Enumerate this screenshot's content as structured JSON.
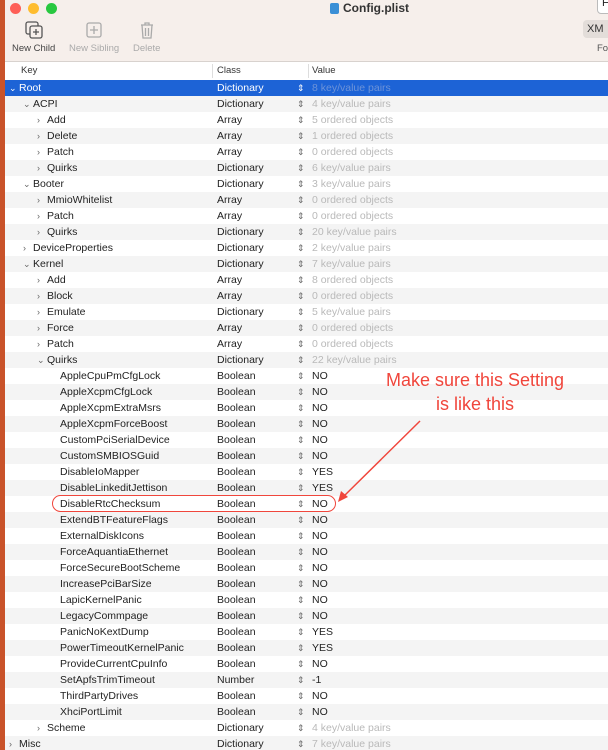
{
  "window": {
    "title": "Config.plist",
    "right_button": "F",
    "format_button": "XM",
    "format_label": "Fo"
  },
  "toolbar": {
    "new_child": "New Child",
    "new_sibling": "New Sibling",
    "delete": "Delete"
  },
  "columns": {
    "key": "Key",
    "class": "Class",
    "value": "Value"
  },
  "colors": {
    "selection": "#1d63d6",
    "annotation": "#f0463c",
    "close": "#fe5f57",
    "minimize": "#febc2e",
    "zoom": "#28c840"
  },
  "annotation": {
    "line1": "Make sure this Setting",
    "line2": "is like this",
    "highlighted_key": "DisableRtcChecksum"
  },
  "rows": [
    {
      "key": "Root",
      "class": "Dictionary",
      "value": "8 key/value pairs",
      "level": 0,
      "state": "open",
      "selected": true
    },
    {
      "key": "ACPI",
      "class": "Dictionary",
      "value": "4 key/value pairs",
      "level": 1,
      "state": "open"
    },
    {
      "key": "Add",
      "class": "Array",
      "value": "5 ordered objects",
      "level": 2,
      "state": "closed"
    },
    {
      "key": "Delete",
      "class": "Array",
      "value": "1 ordered objects",
      "level": 2,
      "state": "closed"
    },
    {
      "key": "Patch",
      "class": "Array",
      "value": "0 ordered objects",
      "level": 2,
      "state": "closed"
    },
    {
      "key": "Quirks",
      "class": "Dictionary",
      "value": "6 key/value pairs",
      "level": 2,
      "state": "closed"
    },
    {
      "key": "Booter",
      "class": "Dictionary",
      "value": "3 key/value pairs",
      "level": 1,
      "state": "open"
    },
    {
      "key": "MmioWhitelist",
      "class": "Array",
      "value": "0 ordered objects",
      "level": 2,
      "state": "closed"
    },
    {
      "key": "Patch",
      "class": "Array",
      "value": "0 ordered objects",
      "level": 2,
      "state": "closed"
    },
    {
      "key": "Quirks",
      "class": "Dictionary",
      "value": "20 key/value pairs",
      "level": 2,
      "state": "closed"
    },
    {
      "key": "DeviceProperties",
      "class": "Dictionary",
      "value": "2 key/value pairs",
      "level": 1,
      "state": "closed"
    },
    {
      "key": "Kernel",
      "class": "Dictionary",
      "value": "7 key/value pairs",
      "level": 1,
      "state": "open"
    },
    {
      "key": "Add",
      "class": "Array",
      "value": "8 ordered objects",
      "level": 2,
      "state": "closed"
    },
    {
      "key": "Block",
      "class": "Array",
      "value": "0 ordered objects",
      "level": 2,
      "state": "closed"
    },
    {
      "key": "Emulate",
      "class": "Dictionary",
      "value": "5 key/value pairs",
      "level": 2,
      "state": "closed"
    },
    {
      "key": "Force",
      "class": "Array",
      "value": "0 ordered objects",
      "level": 2,
      "state": "closed"
    },
    {
      "key": "Patch",
      "class": "Array",
      "value": "0 ordered objects",
      "level": 2,
      "state": "closed"
    },
    {
      "key": "Quirks",
      "class": "Dictionary",
      "value": "22 key/value pairs",
      "level": 2,
      "state": "open"
    },
    {
      "key": "AppleCpuPmCfgLock",
      "class": "Boolean",
      "value": "NO",
      "level": 3,
      "state": "leaf"
    },
    {
      "key": "AppleXcpmCfgLock",
      "class": "Boolean",
      "value": "NO",
      "level": 3,
      "state": "leaf"
    },
    {
      "key": "AppleXcpmExtraMsrs",
      "class": "Boolean",
      "value": "NO",
      "level": 3,
      "state": "leaf"
    },
    {
      "key": "AppleXcpmForceBoost",
      "class": "Boolean",
      "value": "NO",
      "level": 3,
      "state": "leaf"
    },
    {
      "key": "CustomPciSerialDevice",
      "class": "Boolean",
      "value": "NO",
      "level": 3,
      "state": "leaf"
    },
    {
      "key": "CustomSMBIOSGuid",
      "class": "Boolean",
      "value": "NO",
      "level": 3,
      "state": "leaf"
    },
    {
      "key": "DisableIoMapper",
      "class": "Boolean",
      "value": "YES",
      "level": 3,
      "state": "leaf"
    },
    {
      "key": "DisableLinkeditJettison",
      "class": "Boolean",
      "value": "YES",
      "level": 3,
      "state": "leaf"
    },
    {
      "key": "DisableRtcChecksum",
      "class": "Boolean",
      "value": "NO",
      "level": 3,
      "state": "leaf"
    },
    {
      "key": "ExtendBTFeatureFlags",
      "class": "Boolean",
      "value": "NO",
      "level": 3,
      "state": "leaf"
    },
    {
      "key": "ExternalDiskIcons",
      "class": "Boolean",
      "value": "NO",
      "level": 3,
      "state": "leaf"
    },
    {
      "key": "ForceAquantiaEthernet",
      "class": "Boolean",
      "value": "NO",
      "level": 3,
      "state": "leaf"
    },
    {
      "key": "ForceSecureBootScheme",
      "class": "Boolean",
      "value": "NO",
      "level": 3,
      "state": "leaf"
    },
    {
      "key": "IncreasePciBarSize",
      "class": "Boolean",
      "value": "NO",
      "level": 3,
      "state": "leaf"
    },
    {
      "key": "LapicKernelPanic",
      "class": "Boolean",
      "value": "NO",
      "level": 3,
      "state": "leaf"
    },
    {
      "key": "LegacyCommpage",
      "class": "Boolean",
      "value": "NO",
      "level": 3,
      "state": "leaf"
    },
    {
      "key": "PanicNoKextDump",
      "class": "Boolean",
      "value": "YES",
      "level": 3,
      "state": "leaf"
    },
    {
      "key": "PowerTimeoutKernelPanic",
      "class": "Boolean",
      "value": "YES",
      "level": 3,
      "state": "leaf"
    },
    {
      "key": "ProvideCurrentCpuInfo",
      "class": "Boolean",
      "value": "NO",
      "level": 3,
      "state": "leaf"
    },
    {
      "key": "SetApfsTrimTimeout",
      "class": "Number",
      "value": "-1",
      "level": 3,
      "state": "leaf"
    },
    {
      "key": "ThirdPartyDrives",
      "class": "Boolean",
      "value": "NO",
      "level": 3,
      "state": "leaf"
    },
    {
      "key": "XhciPortLimit",
      "class": "Boolean",
      "value": "NO",
      "level": 3,
      "state": "leaf"
    },
    {
      "key": "Scheme",
      "class": "Dictionary",
      "value": "4 key/value pairs",
      "level": 2,
      "state": "closed"
    },
    {
      "key": "Misc",
      "class": "Dictionary",
      "value": "7 key/value pairs",
      "level": 0,
      "state": "closed"
    }
  ]
}
